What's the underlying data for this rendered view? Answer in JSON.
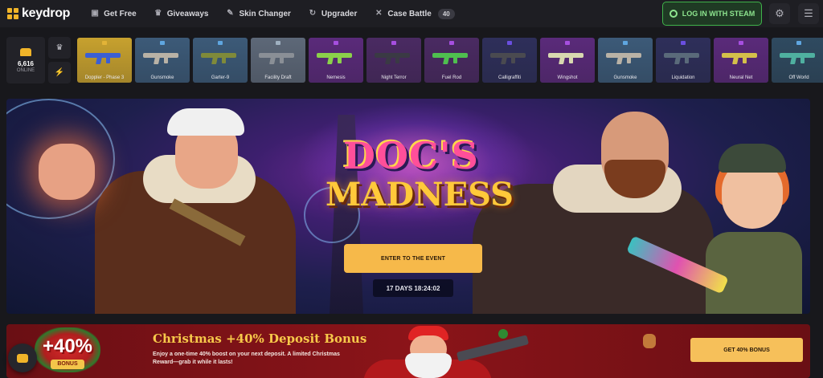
{
  "app": {
    "logo_text": "keydrop"
  },
  "nav": {
    "items": [
      {
        "label": "Get Free",
        "icon": "gift-icon"
      },
      {
        "label": "Giveaways",
        "icon": "trophy-icon"
      },
      {
        "label": "Skin Changer",
        "icon": "pencil-icon"
      },
      {
        "label": "Upgrader",
        "icon": "refresh-icon"
      },
      {
        "label": "Case Battle",
        "icon": "swords-icon",
        "badge": "40"
      }
    ],
    "login_label": "LOG IN WITH STEAM",
    "settings_icon": "gear-icon",
    "menu_icon": "hamburger-icon"
  },
  "live": {
    "online_count": "6,616",
    "online_label": "ONLINE",
    "drops": [
      {
        "name": "Doppler - Phase 3",
        "rarity_color": "#e3b437",
        "bg": "#c7a12e",
        "gun_color": "#3b5fd4"
      },
      {
        "name": "Gunsmoke",
        "rarity_color": "#5fa6e0",
        "bg": "#3c5a78",
        "gun_color": "#b9b2a6"
      },
      {
        "name": "Garter-9",
        "rarity_color": "#5fa6e0",
        "bg": "#3c5a78",
        "gun_color": "#7f8a3a"
      },
      {
        "name": "Facility Draft",
        "rarity_color": "#9fb0c0",
        "bg": "#5d6878",
        "gun_color": "#8a8f96"
      },
      {
        "name": "Nemesis",
        "rarity_color": "#a64fe0",
        "bg": "#5a2a7a",
        "gun_color": "#8bd14a"
      },
      {
        "name": "Night Terror",
        "rarity_color": "#a64fe0",
        "bg": "#4a2a62",
        "gun_color": "#3a3a44"
      },
      {
        "name": "Fuel Rod",
        "rarity_color": "#a64fe0",
        "bg": "#4a2a62",
        "gun_color": "#4fbf4f"
      },
      {
        "name": "Calligraffiti",
        "rarity_color": "#6a4fe0",
        "bg": "#2e2f5a",
        "gun_color": "#4a4a50"
      },
      {
        "name": "Wingshot",
        "rarity_color": "#a64fe0",
        "bg": "#5a2a7a",
        "gun_color": "#d8d8b0"
      },
      {
        "name": "Gunsmoke",
        "rarity_color": "#5fa6e0",
        "bg": "#3c5a78",
        "gun_color": "#b9b2a6"
      },
      {
        "name": "Liquidation",
        "rarity_color": "#6a4fe0",
        "bg": "#2e2f5a",
        "gun_color": "#5a6a7a"
      },
      {
        "name": "Neural Net",
        "rarity_color": "#a64fe0",
        "bg": "#5a2a7a",
        "gun_color": "#d4c04a"
      },
      {
        "name": "Off World",
        "rarity_color": "#5fa6e0",
        "bg": "#2f4a60",
        "gun_color": "#4fb0a0"
      }
    ]
  },
  "hero": {
    "title_line1": "DOC'S",
    "title_line2": "MADNESS",
    "cta_label": "ENTER TO THE EVENT",
    "timer": "17 DAYS 18:24:02"
  },
  "bonus": {
    "badge_pct": "+40%",
    "badge_word": "BONUS",
    "title": "Christmas +40% Deposit Bonus",
    "description": "Enjoy a one-time 40% boost on your next deposit. A limited Christmas Reward—grab it while it lasts!",
    "cta_label": "GET 40% BONUS"
  },
  "colors": {
    "accent": "#f0b429",
    "login_green": "#3fb24a",
    "bonus_red": "#8b1419"
  }
}
